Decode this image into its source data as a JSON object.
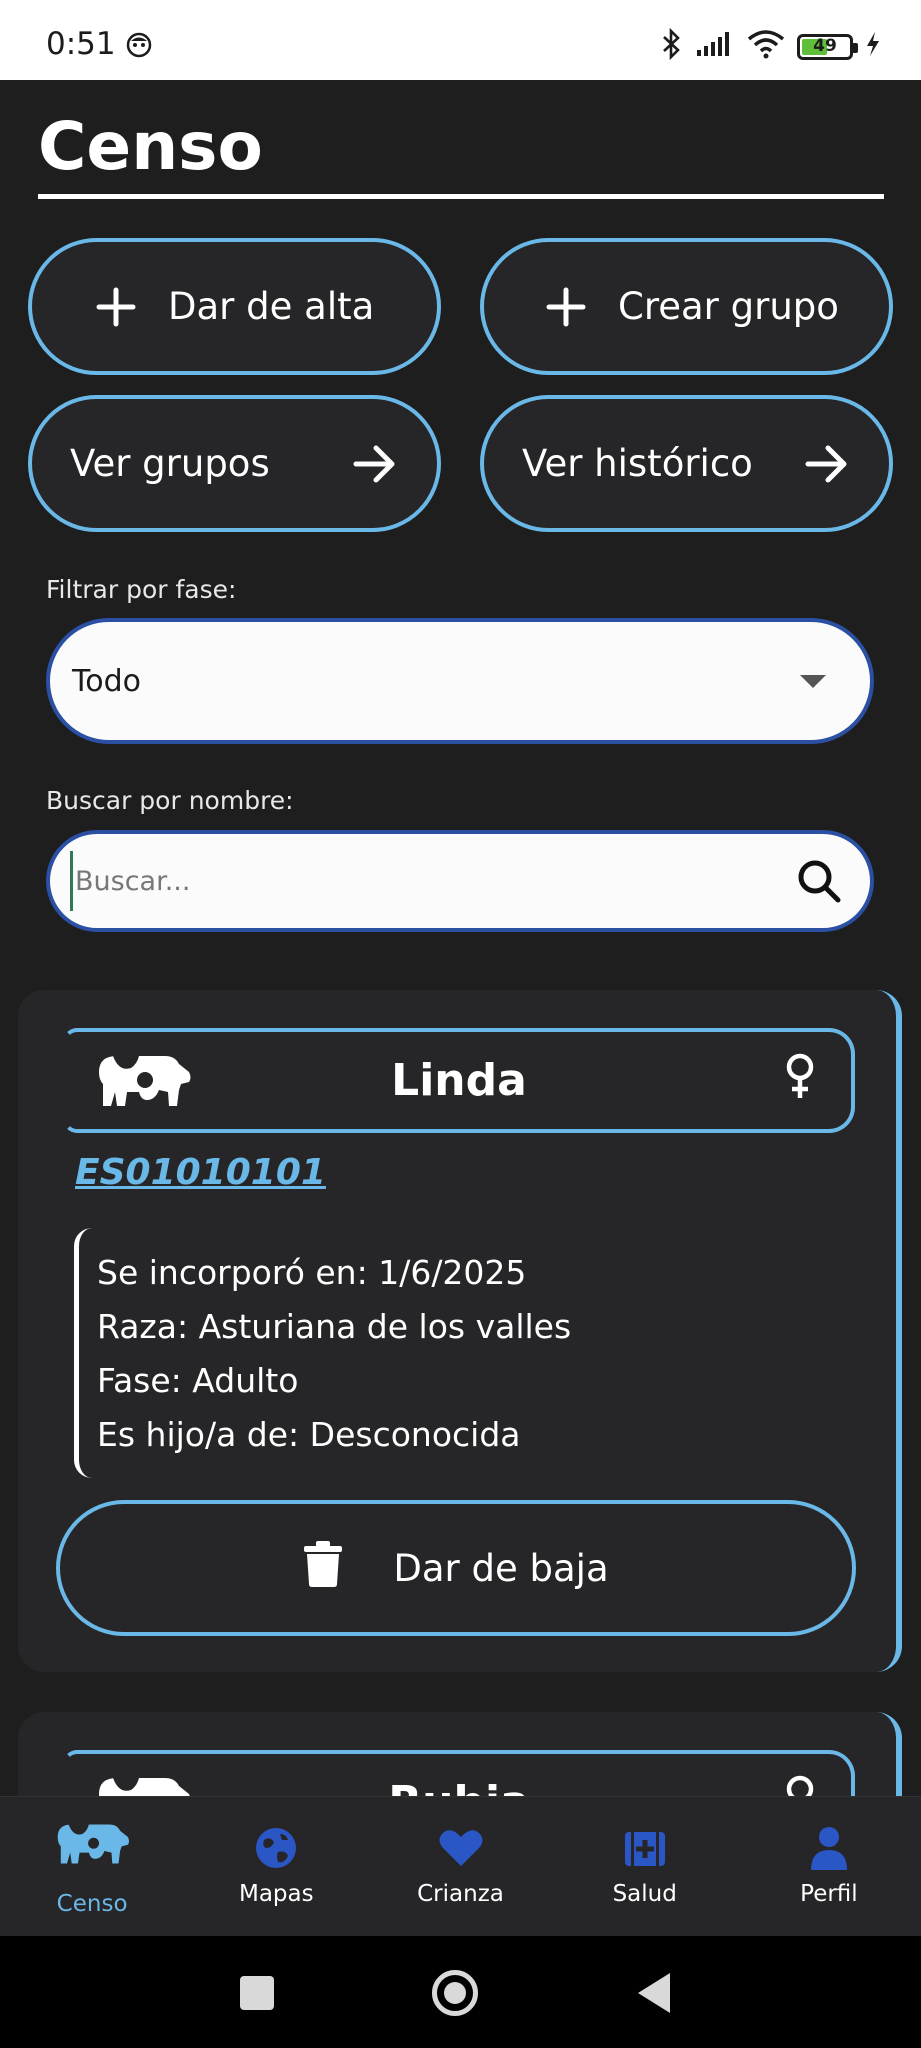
{
  "status_bar": {
    "time": "0:51",
    "battery_level": "49"
  },
  "header": {
    "title": "Censo"
  },
  "actions": {
    "add_label": "Dar de alta",
    "create_group_label": "Crear grupo",
    "view_groups_label": "Ver grupos",
    "view_history_label": "Ver histórico"
  },
  "filters": {
    "phase_label": "Filtrar por fase:",
    "phase_value": "Todo",
    "search_label": "Buscar por nombre:",
    "search_placeholder": "Buscar..."
  },
  "animals": [
    {
      "name": "Linda",
      "gender": "female",
      "id": "ES01010101",
      "joined": "Se incorporó en: 1/6/2025",
      "breed": "Raza: Asturiana de los valles",
      "phase": "Fase: Adulto",
      "parent": "Es hijo/a de: Desconocida",
      "remove_label": "Dar de baja"
    },
    {
      "name": "Rubia",
      "gender": "female"
    }
  ],
  "bottom_nav": [
    {
      "label": "Censo",
      "icon": "cow-icon",
      "active": true
    },
    {
      "label": "Mapas",
      "icon": "globe-icon",
      "active": false
    },
    {
      "label": "Crianza",
      "icon": "heart-icon",
      "active": false
    },
    {
      "label": "Salud",
      "icon": "medkit-icon",
      "active": false
    },
    {
      "label": "Perfil",
      "icon": "person-icon",
      "active": false
    }
  ],
  "colors": {
    "accent": "#6ab8e8",
    "nav_icon": "#2a56c6",
    "background": "#1e1e1f",
    "card": "#262628"
  }
}
